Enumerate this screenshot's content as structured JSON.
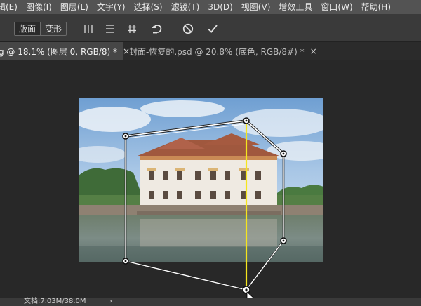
{
  "menubar": {
    "items": [
      {
        "label": "辑(E)"
      },
      {
        "label": "图像(I)"
      },
      {
        "label": "图层(L)"
      },
      {
        "label": "文字(Y)"
      },
      {
        "label": "选择(S)"
      },
      {
        "label": "滤镜(T)"
      },
      {
        "label": "3D(D)"
      },
      {
        "label": "视图(V)"
      },
      {
        "label": "增效工具"
      },
      {
        "label": "窗口(W)"
      },
      {
        "label": "帮助(H)"
      }
    ]
  },
  "options": {
    "mode_layout": "版面",
    "mode_warp": "变形",
    "icons": [
      "vertical-split-icon",
      "horizontal-split-icon",
      "cross-split-icon",
      "reset-icon",
      "cancel-icon",
      "commit-icon"
    ]
  },
  "tabs": [
    {
      "title": "g @ 18.1% (图层 0, RGB/8) *",
      "close": "×"
    },
    {
      "title": "封面-恢复的.psd @ 20.8% (底色, RGB/8#) *",
      "close": "×"
    }
  ],
  "status": {
    "doc_info": "文档:7.03M/38.0M",
    "arrow": "›"
  },
  "colors": {
    "menubar": "#535353",
    "optionsbar": "#3a3a3a",
    "workspace": "#282828",
    "split_line": "#f5e51e",
    "warp_frame": "#ffffff"
  }
}
